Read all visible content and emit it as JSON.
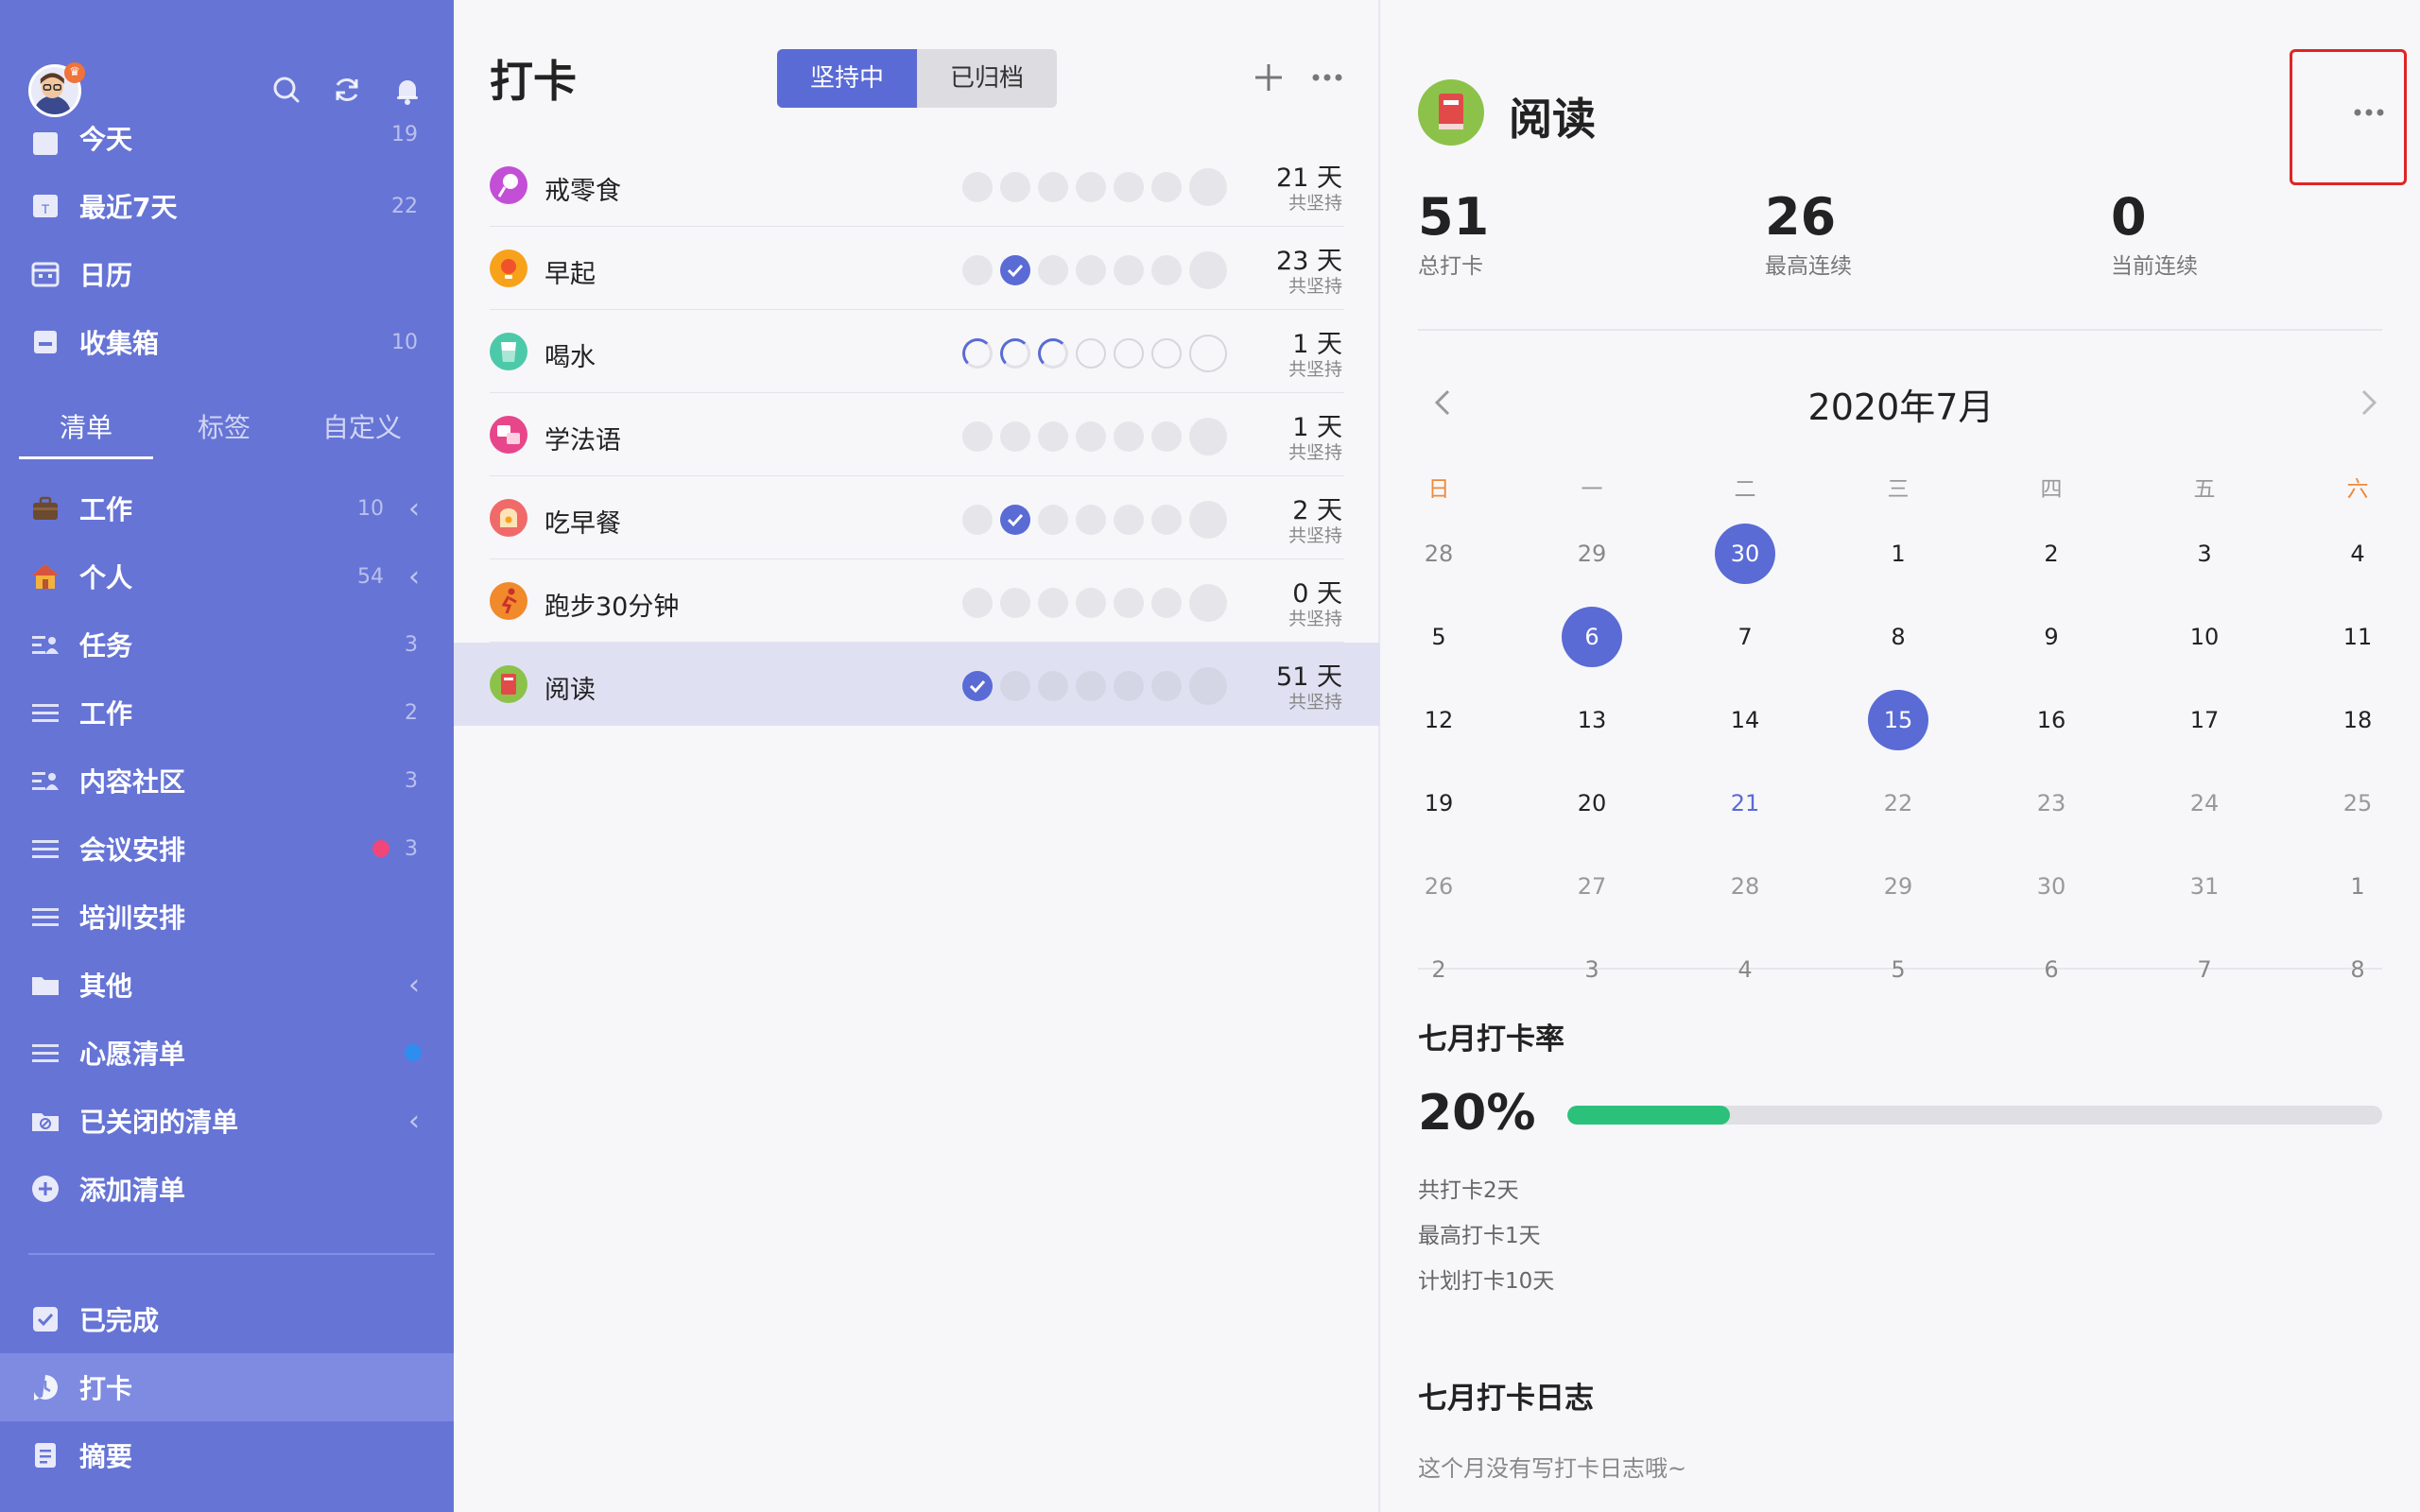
{
  "sidebar": {
    "items": [
      {
        "label": "今天",
        "count": "19"
      },
      {
        "label": "最近7天",
        "count": "22"
      },
      {
        "label": "日历",
        "count": ""
      },
      {
        "label": "收集箱",
        "count": "10"
      }
    ],
    "tabs": [
      "清单",
      "标签",
      "自定义"
    ],
    "lists": [
      {
        "label": "工作",
        "count": "10",
        "icon": "briefcase-icon"
      },
      {
        "label": "个人",
        "count": "54",
        "icon": "house-icon"
      },
      {
        "label": "任务",
        "count": "3",
        "icon": "shared-list-icon"
      },
      {
        "label": "工作",
        "count": "2",
        "icon": "list-icon"
      },
      {
        "label": "内容社区",
        "count": "3",
        "icon": "shared-list-icon"
      },
      {
        "label": "会议安排",
        "count": "3",
        "icon": "list-icon",
        "dot_color": "#f0467a"
      },
      {
        "label": "培训安排",
        "count": "",
        "icon": "list-icon"
      },
      {
        "label": "其他",
        "count": "",
        "icon": "folder-icon"
      },
      {
        "label": "心愿清单",
        "count": "",
        "icon": "list-icon",
        "dot_color": "#2d8ef0"
      },
      {
        "label": "已关闭的清单",
        "count": "",
        "icon": "closed-list-icon"
      },
      {
        "label": "添加清单",
        "count": "",
        "icon": "plus-circle-icon"
      }
    ],
    "bottom": [
      {
        "label": "已完成"
      },
      {
        "label": "打卡"
      },
      {
        "label": "摘要"
      }
    ]
  },
  "list_panel": {
    "title": "打卡",
    "segments": [
      "坚持中",
      "已归档"
    ],
    "habits": [
      {
        "name": "戒零食",
        "days": "21 天",
        "sub": "共坚持",
        "icon_color": "#c34fd6",
        "icon": "lollipop-icon"
      },
      {
        "name": "早起",
        "days": "23 天",
        "sub": "共坚持",
        "icon_color": "#f7a21a",
        "icon": "sunrise-icon"
      },
      {
        "name": "喝水",
        "days": "1 天",
        "sub": "共坚持",
        "icon_color": "#4cc9a8",
        "icon": "water-glass-icon"
      },
      {
        "name": "学法语",
        "days": "1 天",
        "sub": "共坚持",
        "icon_color": "#e8468a",
        "icon": "translate-icon"
      },
      {
        "name": "吃早餐",
        "days": "2 天",
        "sub": "共坚持",
        "icon_color": "#f06a6a",
        "icon": "toast-icon"
      },
      {
        "name": "跑步30分钟",
        "days": "0 天",
        "sub": "共坚持",
        "icon_color": "#f08a2a",
        "icon": "running-icon"
      },
      {
        "name": "阅读",
        "days": "51 天",
        "sub": "共坚持",
        "icon_color": "#8cc24a",
        "icon": "book-icon"
      }
    ]
  },
  "detail": {
    "title": "阅读",
    "stats": [
      {
        "value": "51",
        "label": "总打卡"
      },
      {
        "value": "26",
        "label": "最高连续"
      },
      {
        "value": "0",
        "label": "当前连续"
      }
    ],
    "calendar": {
      "month_title": "2020年7月",
      "weekdays": [
        "日",
        "一",
        "二",
        "三",
        "四",
        "五",
        "六"
      ],
      "weeks": [
        [
          "28",
          "29",
          "30",
          "1",
          "2",
          "3",
          "4"
        ],
        [
          "5",
          "6",
          "7",
          "8",
          "9",
          "10",
          "11"
        ],
        [
          "12",
          "13",
          "14",
          "15",
          "16",
          "17",
          "18"
        ],
        [
          "19",
          "20",
          "21",
          "22",
          "23",
          "24",
          "25"
        ],
        [
          "26",
          "27",
          "28",
          "29",
          "30",
          "31",
          "1"
        ],
        [
          "2",
          "3",
          "4",
          "5",
          "6",
          "7",
          "8"
        ]
      ],
      "checked_days": [
        "30",
        "6",
        "15"
      ],
      "today": "21"
    },
    "rate": {
      "title": "七月打卡率",
      "percent_text": "20%",
      "percent": 0.2,
      "lines": [
        "共打卡2天",
        "最高打卡1天",
        "计划打卡10天"
      ]
    },
    "log": {
      "title": "七月打卡日志",
      "empty_text": "这个月没有写打卡日志哦~"
    }
  },
  "colors": {
    "sidebar_bg": "#6674d6",
    "accent": "#5a6bd5",
    "progress_green": "#2cc17b",
    "weekend": "#f0893a"
  }
}
